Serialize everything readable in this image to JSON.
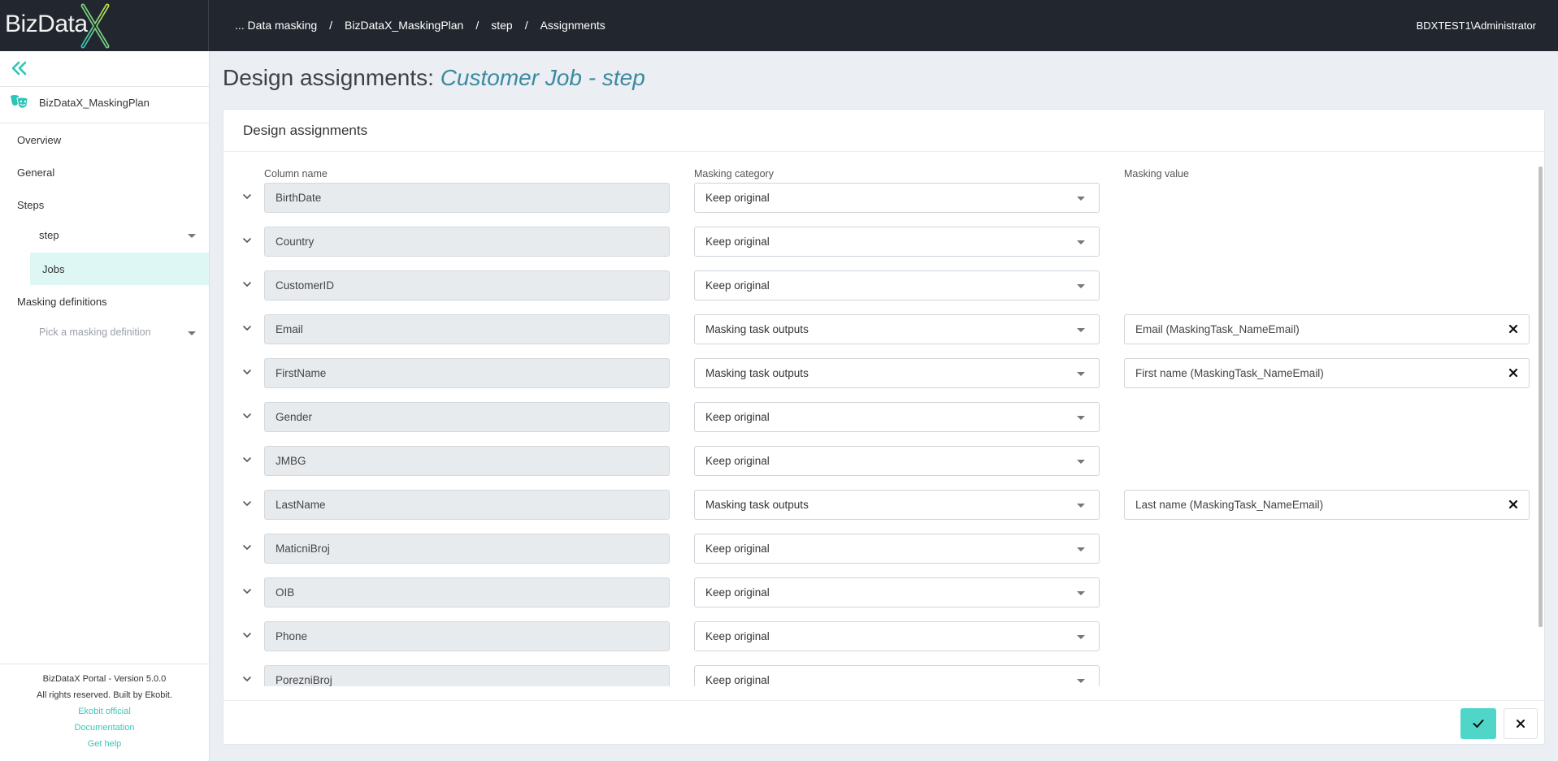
{
  "app": {
    "logo_text": "BizData",
    "logo_accent": "X"
  },
  "breadcrumb": [
    {
      "label": "... Data masking"
    },
    {
      "label": "BizDataX_MaskingPlan"
    },
    {
      "label": "step"
    },
    {
      "label": "Assignments"
    }
  ],
  "user": "BDXTEST1\\Administrator",
  "sidebar": {
    "plan_name": "BizDataX_MaskingPlan",
    "items": {
      "overview": "Overview",
      "general": "General",
      "steps": "Steps",
      "step": "step",
      "jobs": "Jobs",
      "masking_definitions": "Masking definitions",
      "pick_definition_placeholder": "Pick a masking definition"
    },
    "footer": {
      "version": "BizDataX Portal - Version 5.0.0",
      "rights": "All rights reserved. Built by Ekobit.",
      "links": [
        "Ekobit official",
        "Documentation",
        "Get help"
      ]
    }
  },
  "page": {
    "title_prefix": "Design assignments: ",
    "title_subject": "Customer Job - step"
  },
  "card": {
    "title": "Design assignments",
    "columns": {
      "column_name": "Column name",
      "masking_category": "Masking category",
      "masking_value": "Masking value"
    },
    "rows": [
      {
        "column": "BirthDate",
        "category": "Keep original",
        "value": null
      },
      {
        "column": "Country",
        "category": "Keep original",
        "value": null
      },
      {
        "column": "CustomerID",
        "category": "Keep original",
        "value": null
      },
      {
        "column": "Email",
        "category": "Masking task outputs",
        "value": "Email (MaskingTask_NameEmail)"
      },
      {
        "column": "FirstName",
        "category": "Masking task outputs",
        "value": "First name (MaskingTask_NameEmail)"
      },
      {
        "column": "Gender",
        "category": "Keep original",
        "value": null
      },
      {
        "column": "JMBG",
        "category": "Keep original",
        "value": null
      },
      {
        "column": "LastName",
        "category": "Masking task outputs",
        "value": "Last name (MaskingTask_NameEmail)"
      },
      {
        "column": "MaticniBroj",
        "category": "Keep original",
        "value": null
      },
      {
        "column": "OIB",
        "category": "Keep original",
        "value": null
      },
      {
        "column": "Phone",
        "category": "Keep original",
        "value": null
      },
      {
        "column": "PorezniBroj",
        "category": "Keep original",
        "value": null
      }
    ]
  },
  "colors": {
    "accent": "#4fd6c8",
    "topbar": "#22262f",
    "title_accent": "#3a8aa0"
  }
}
